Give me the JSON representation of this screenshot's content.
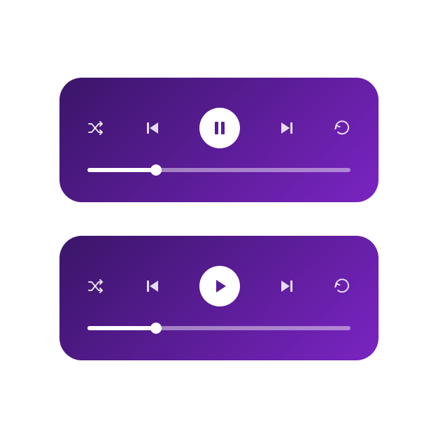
{
  "players": [
    {
      "state": "playing",
      "controls": {
        "shuffle": "Shuffle",
        "previous": "Previous",
        "playpause": "Pause",
        "next": "Next",
        "repeat": "Repeat"
      },
      "progress_percent": 26
    },
    {
      "state": "paused",
      "controls": {
        "shuffle": "Shuffle",
        "previous": "Previous",
        "playpause": "Play",
        "next": "Next",
        "repeat": "Repeat"
      },
      "progress_percent": 26
    }
  ],
  "colors": {
    "gradient_start": "#3a1569",
    "gradient_end": "#7a24c2",
    "accent": "#ffffff"
  }
}
